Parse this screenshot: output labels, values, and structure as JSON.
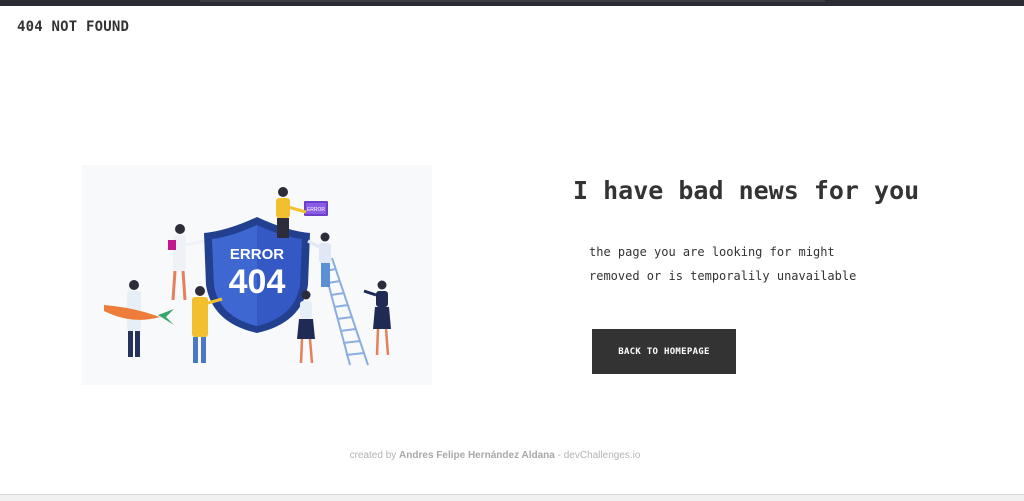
{
  "header": {
    "brand": "404 NOT FOUND"
  },
  "illustration": {
    "shield_line1": "ERROR",
    "shield_line2": "404",
    "laptop_text": "ERROR"
  },
  "main": {
    "headline": "I have bad news for you",
    "message_line1": "the page you are looking for might",
    "message_line2": "removed or is temporalily unavailable",
    "button_label": "BACK TO HOMEPAGE"
  },
  "footer": {
    "prefix": "created by ",
    "author": "Andres Felipe Hernández Aldana",
    "separator": " - ",
    "site": "devChallenges.io"
  },
  "colors": {
    "text": "#333333",
    "button_bg": "#333333",
    "shield_blue": "#2c4ea8",
    "accent_yellow": "#f2c02e"
  }
}
